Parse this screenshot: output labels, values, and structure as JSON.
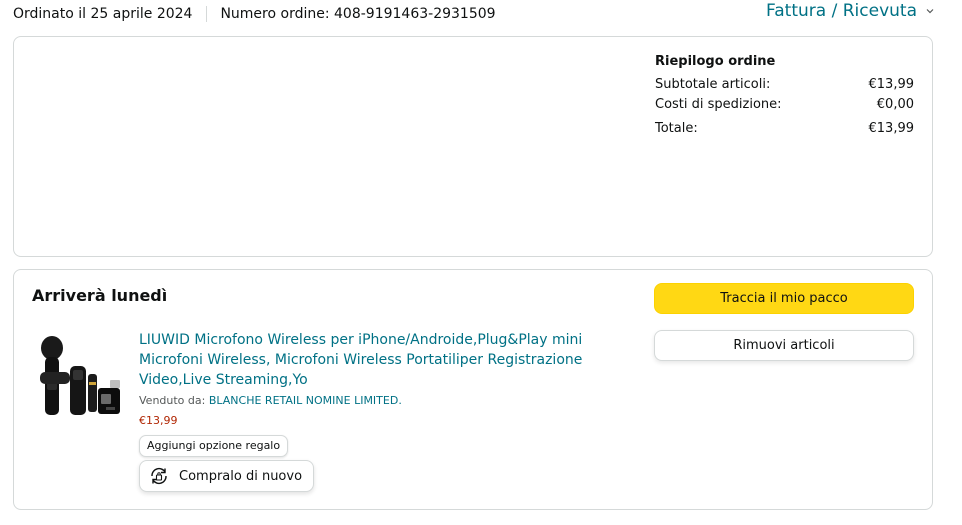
{
  "header": {
    "order_date": "Ordinato il 25 aprile 2024",
    "order_number": "Numero ordine: 408-9191463-2931509",
    "invoice_link": "Fattura / Ricevuta"
  },
  "summary": {
    "title": "Riepilogo ordine",
    "rows": [
      {
        "label": "Subtotale articoli:",
        "value": "€13,99"
      },
      {
        "label": "Costi di spedizione:",
        "value": "€0,00"
      },
      {
        "label": "Totale:",
        "value": "€13,99"
      }
    ]
  },
  "shipment": {
    "arrival": "Arriverà lunedì",
    "product": {
      "title": "LIUWID Microfono Wireless per iPhone/Androide,Plug&Play mini Microfoni Wireless, Microfoni Wireless Portatiliper Registrazione Video,Live Streaming,Yo",
      "sold_by_label": "Venduto da:",
      "seller": "BLANCHE RETAIL NOMINE LIMITED.",
      "price": "€13,99",
      "image_icon": "wireless-microphone-product"
    },
    "gift_button": "Aggiungi opzione regalo",
    "rebuy_button": "Compralo di nuovo",
    "track_button": "Traccia il mio pacco",
    "remove_button": "Rimuovi articoli"
  },
  "colors": {
    "link": "#007185",
    "price": "#b12704",
    "primary_button": "#ffd814",
    "border": "#d5d9d9"
  }
}
